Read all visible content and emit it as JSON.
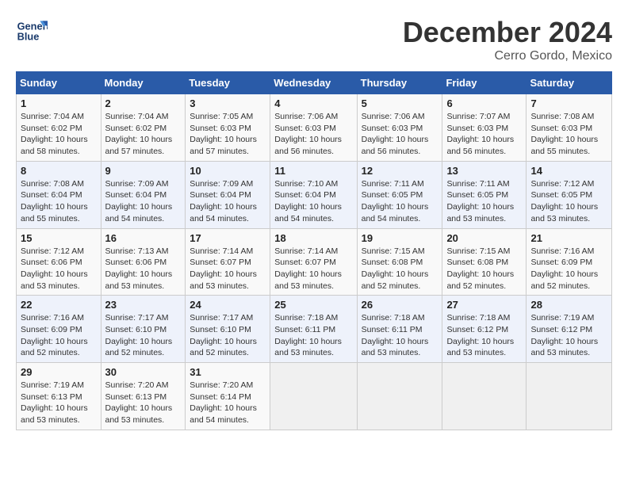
{
  "header": {
    "logo_line1": "General",
    "logo_line2": "Blue",
    "title": "December 2024",
    "subtitle": "Cerro Gordo, Mexico"
  },
  "calendar": {
    "days_of_week": [
      "Sunday",
      "Monday",
      "Tuesday",
      "Wednesday",
      "Thursday",
      "Friday",
      "Saturday"
    ],
    "weeks": [
      [
        {
          "day": "",
          "info": ""
        },
        {
          "day": "2",
          "info": "Sunrise: 7:04 AM\nSunset: 6:02 PM\nDaylight: 10 hours\nand 57 minutes."
        },
        {
          "day": "3",
          "info": "Sunrise: 7:05 AM\nSunset: 6:03 PM\nDaylight: 10 hours\nand 57 minutes."
        },
        {
          "day": "4",
          "info": "Sunrise: 7:06 AM\nSunset: 6:03 PM\nDaylight: 10 hours\nand 56 minutes."
        },
        {
          "day": "5",
          "info": "Sunrise: 7:06 AM\nSunset: 6:03 PM\nDaylight: 10 hours\nand 56 minutes."
        },
        {
          "day": "6",
          "info": "Sunrise: 7:07 AM\nSunset: 6:03 PM\nDaylight: 10 hours\nand 56 minutes."
        },
        {
          "day": "7",
          "info": "Sunrise: 7:08 AM\nSunset: 6:03 PM\nDaylight: 10 hours\nand 55 minutes."
        }
      ],
      [
        {
          "day": "1",
          "info": "Sunrise: 7:04 AM\nSunset: 6:02 PM\nDaylight: 10 hours\nand 58 minutes."
        },
        {
          "day": "8",
          "info": ""
        },
        {
          "day": "",
          "info": ""
        },
        {
          "day": "",
          "info": ""
        },
        {
          "day": "",
          "info": ""
        },
        {
          "day": "",
          "info": ""
        },
        {
          "day": "",
          "info": ""
        }
      ],
      [
        {
          "day": "8",
          "info": "Sunrise: 7:08 AM\nSunset: 6:04 PM\nDaylight: 10 hours\nand 55 minutes."
        },
        {
          "day": "9",
          "info": "Sunrise: 7:09 AM\nSunset: 6:04 PM\nDaylight: 10 hours\nand 54 minutes."
        },
        {
          "day": "10",
          "info": "Sunrise: 7:09 AM\nSunset: 6:04 PM\nDaylight: 10 hours\nand 54 minutes."
        },
        {
          "day": "11",
          "info": "Sunrise: 7:10 AM\nSunset: 6:04 PM\nDaylight: 10 hours\nand 54 minutes."
        },
        {
          "day": "12",
          "info": "Sunrise: 7:11 AM\nSunset: 6:05 PM\nDaylight: 10 hours\nand 54 minutes."
        },
        {
          "day": "13",
          "info": "Sunrise: 7:11 AM\nSunset: 6:05 PM\nDaylight: 10 hours\nand 53 minutes."
        },
        {
          "day": "14",
          "info": "Sunrise: 7:12 AM\nSunset: 6:05 PM\nDaylight: 10 hours\nand 53 minutes."
        }
      ],
      [
        {
          "day": "15",
          "info": "Sunrise: 7:12 AM\nSunset: 6:06 PM\nDaylight: 10 hours\nand 53 minutes."
        },
        {
          "day": "16",
          "info": "Sunrise: 7:13 AM\nSunset: 6:06 PM\nDaylight: 10 hours\nand 53 minutes."
        },
        {
          "day": "17",
          "info": "Sunrise: 7:14 AM\nSunset: 6:07 PM\nDaylight: 10 hours\nand 53 minutes."
        },
        {
          "day": "18",
          "info": "Sunrise: 7:14 AM\nSunset: 6:07 PM\nDaylight: 10 hours\nand 53 minutes."
        },
        {
          "day": "19",
          "info": "Sunrise: 7:15 AM\nSunset: 6:08 PM\nDaylight: 10 hours\nand 52 minutes."
        },
        {
          "day": "20",
          "info": "Sunrise: 7:15 AM\nSunset: 6:08 PM\nDaylight: 10 hours\nand 52 minutes."
        },
        {
          "day": "21",
          "info": "Sunrise: 7:16 AM\nSunset: 6:09 PM\nDaylight: 10 hours\nand 52 minutes."
        }
      ],
      [
        {
          "day": "22",
          "info": "Sunrise: 7:16 AM\nSunset: 6:09 PM\nDaylight: 10 hours\nand 52 minutes."
        },
        {
          "day": "23",
          "info": "Sunrise: 7:17 AM\nSunset: 6:10 PM\nDaylight: 10 hours\nand 52 minutes."
        },
        {
          "day": "24",
          "info": "Sunrise: 7:17 AM\nSunset: 6:10 PM\nDaylight: 10 hours\nand 52 minutes."
        },
        {
          "day": "25",
          "info": "Sunrise: 7:18 AM\nSunset: 6:11 PM\nDaylight: 10 hours\nand 53 minutes."
        },
        {
          "day": "26",
          "info": "Sunrise: 7:18 AM\nSunset: 6:11 PM\nDaylight: 10 hours\nand 53 minutes."
        },
        {
          "day": "27",
          "info": "Sunrise: 7:18 AM\nSunset: 6:12 PM\nDaylight: 10 hours\nand 53 minutes."
        },
        {
          "day": "28",
          "info": "Sunrise: 7:19 AM\nSunset: 6:12 PM\nDaylight: 10 hours\nand 53 minutes."
        }
      ],
      [
        {
          "day": "29",
          "info": "Sunrise: 7:19 AM\nSunset: 6:13 PM\nDaylight: 10 hours\nand 53 minutes."
        },
        {
          "day": "30",
          "info": "Sunrise: 7:20 AM\nSunset: 6:13 PM\nDaylight: 10 hours\nand 53 minutes."
        },
        {
          "day": "31",
          "info": "Sunrise: 7:20 AM\nSunset: 6:14 PM\nDaylight: 10 hours\nand 54 minutes."
        },
        {
          "day": "",
          "info": ""
        },
        {
          "day": "",
          "info": ""
        },
        {
          "day": "",
          "info": ""
        },
        {
          "day": "",
          "info": ""
        }
      ]
    ],
    "week1": [
      {
        "day": "1",
        "info": "Sunrise: 7:04 AM\nSunset: 6:02 PM\nDaylight: 10 hours\nand 58 minutes."
      },
      {
        "day": "2",
        "info": "Sunrise: 7:04 AM\nSunset: 6:02 PM\nDaylight: 10 hours\nand 57 minutes."
      },
      {
        "day": "3",
        "info": "Sunrise: 7:05 AM\nSunset: 6:03 PM\nDaylight: 10 hours\nand 57 minutes."
      },
      {
        "day": "4",
        "info": "Sunrise: 7:06 AM\nSunset: 6:03 PM\nDaylight: 10 hours\nand 56 minutes."
      },
      {
        "day": "5",
        "info": "Sunrise: 7:06 AM\nSunset: 6:03 PM\nDaylight: 10 hours\nand 56 minutes."
      },
      {
        "day": "6",
        "info": "Sunrise: 7:07 AM\nSunset: 6:03 PM\nDaylight: 10 hours\nand 56 minutes."
      },
      {
        "day": "7",
        "info": "Sunrise: 7:08 AM\nSunset: 6:03 PM\nDaylight: 10 hours\nand 55 minutes."
      }
    ]
  }
}
